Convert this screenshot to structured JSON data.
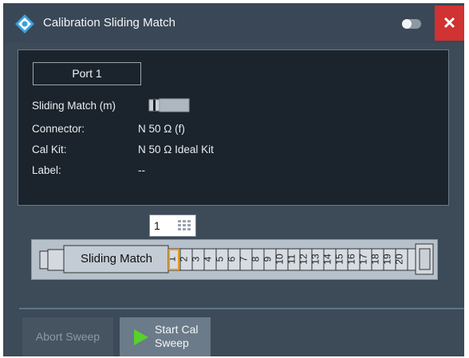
{
  "window": {
    "title": "Calibration Sliding Match",
    "close_label": "×"
  },
  "port": {
    "label": "Port 1",
    "sliding_match_label": "Sliding Match (m)"
  },
  "info": {
    "connector_label": "Connector:",
    "connector_value": "N 50 Ω (f)",
    "cal_kit_label": "Cal Kit:",
    "cal_kit_value": "N 50 Ω Ideal Kit",
    "label_label": "Label:",
    "label_value": "--"
  },
  "position_input": {
    "value": "1"
  },
  "device": {
    "name": "Sliding Match",
    "positions": [
      "1",
      "2",
      "3",
      "4",
      "5",
      "6",
      "7",
      "8",
      "9",
      "10",
      "11",
      "12",
      "13",
      "14",
      "15",
      "16",
      "17",
      "18",
      "19",
      "20"
    ],
    "selected_position": "1"
  },
  "buttons": {
    "abort": "Abort Sweep",
    "start_line1": "Start Cal",
    "start_line2": "Sweep"
  },
  "colors": {
    "accent_selected": "#e69b1f",
    "close_bg": "#d13232",
    "play_green": "#58d12a"
  }
}
